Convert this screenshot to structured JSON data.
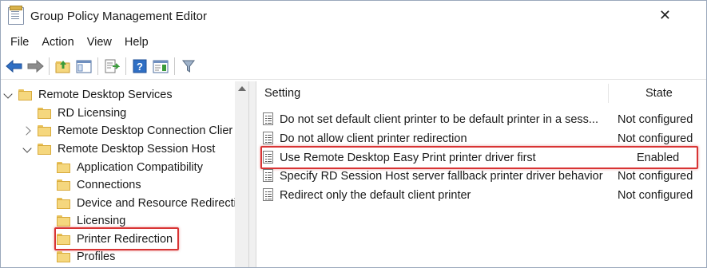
{
  "window": {
    "title": "Group Policy Management Editor",
    "close_glyph": "✕"
  },
  "menu": [
    "File",
    "Action",
    "View",
    "Help"
  ],
  "toolbar": [
    "back-icon",
    "forward-icon",
    "up-folder-icon",
    "show-tree-icon",
    "export-list-icon",
    "help-icon",
    "properties-icon",
    "filter-icon"
  ],
  "tree": {
    "items": [
      {
        "label": "Remote Desktop Services",
        "state": "expanded"
      },
      {
        "label": "RD Licensing",
        "state": "leaf"
      },
      {
        "label": "Remote Desktop Connection Clier",
        "state": "collapsed"
      },
      {
        "label": "Remote Desktop Session Host",
        "state": "expanded"
      },
      {
        "label": "Application Compatibility",
        "state": "leaf"
      },
      {
        "label": "Connections",
        "state": "leaf"
      },
      {
        "label": "Device and Resource Redirecti",
        "state": "leaf"
      },
      {
        "label": "Licensing",
        "state": "leaf"
      },
      {
        "label": "Printer Redirection",
        "state": "selected"
      },
      {
        "label": "Profiles",
        "state": "leaf"
      }
    ]
  },
  "list": {
    "columns": {
      "setting": "Setting",
      "state": "State"
    },
    "rows": [
      {
        "setting": "Do not set default client printer to be default printer in a sess...",
        "state": "Not configured"
      },
      {
        "setting": "Do not allow client printer redirection",
        "state": "Not configured"
      },
      {
        "setting": "Use Remote Desktop Easy Print printer driver first",
        "state": "Enabled"
      },
      {
        "setting": "Specify RD Session Host server fallback printer driver behavior",
        "state": "Not configured"
      },
      {
        "setting": "Redirect only the default client printer",
        "state": "Not configured"
      }
    ]
  },
  "colors": {
    "highlight": "#d83434",
    "accent": "#2f6fc4"
  }
}
